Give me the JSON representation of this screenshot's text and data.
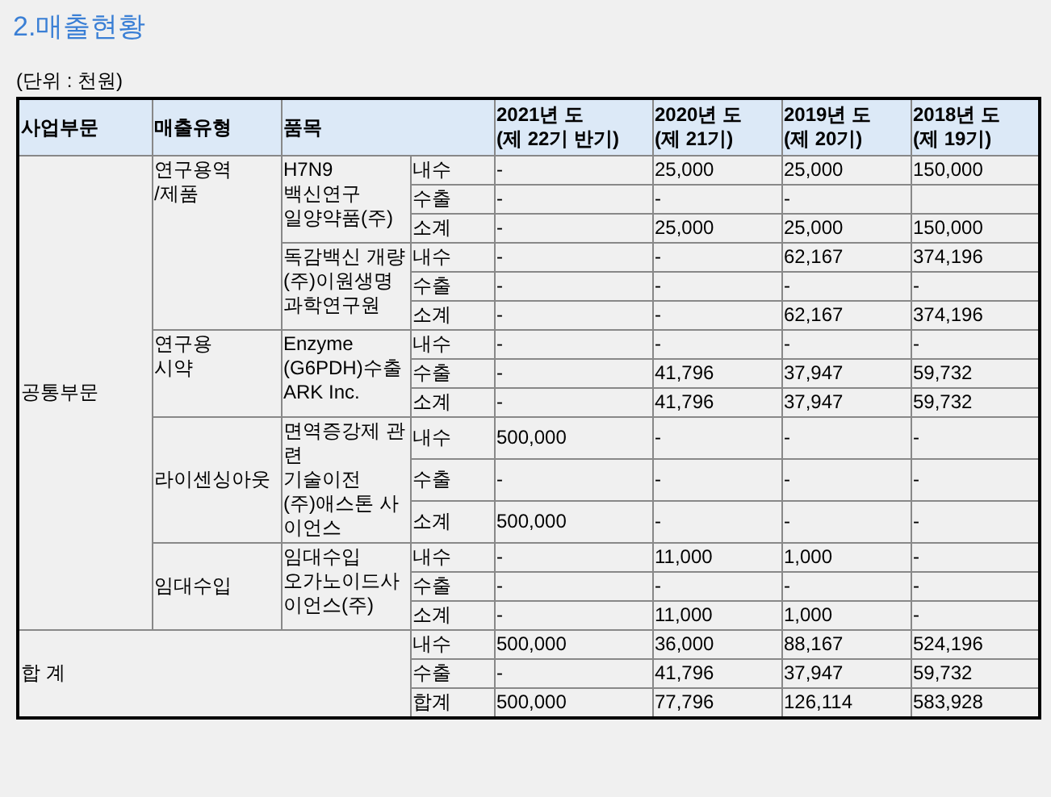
{
  "title": "2.매출현황",
  "unit": "(단위 : 천원)",
  "columns": [
    {
      "lines": [
        "사업부문"
      ]
    },
    {
      "lines": [
        "매출유형"
      ]
    },
    {
      "lines": [
        "품목"
      ]
    },
    {
      "lines": [
        "2021년 도",
        "(제 22기  반기)"
      ]
    },
    {
      "lines": [
        "2020년 도",
        "(제 21기)"
      ]
    },
    {
      "lines": [
        "2019년 도",
        "(제 20기)"
      ]
    },
    {
      "lines": [
        "2018년 도",
        "(제 19기)"
      ]
    }
  ],
  "segments": [
    {
      "name": "공통부문",
      "types": [
        {
          "lines": [
            "연구용역",
            "/제품"
          ],
          "items": [
            {
              "lines": [
                "H7N9",
                "백신연구",
                "일양약품(주)"
              ],
              "rows": [
                {
                  "label": "내수",
                  "values": [
                    "-",
                    "25,000",
                    "25,000",
                    "150,000"
                  ]
                },
                {
                  "label": "수출",
                  "values": [
                    "-",
                    "-",
                    "-"
                  ]
                },
                {
                  "label": "소계",
                  "values": [
                    "-",
                    "25,000",
                    "25,000",
                    "150,000"
                  ]
                }
              ]
            },
            {
              "lines": [
                "독감백신 개량",
                "(주)이원생명",
                "과학연구원"
              ],
              "rows": [
                {
                  "label": "내수",
                  "values": [
                    "-",
                    "-",
                    "62,167",
                    "374,196"
                  ]
                },
                {
                  "label": "수출",
                  "values": [
                    "-",
                    "-",
                    "-",
                    "-"
                  ]
                },
                {
                  "label": "소계",
                  "values": [
                    "-",
                    "-",
                    "62,167",
                    "374,196"
                  ]
                }
              ]
            }
          ]
        },
        {
          "lines": [
            "연구용",
            "시약"
          ],
          "items": [
            {
              "lines": [
                "Enzyme",
                "(G6PDH)수출",
                "ARK Inc."
              ],
              "rows": [
                {
                  "label": "내수",
                  "values": [
                    "-",
                    "-",
                    "-",
                    "-"
                  ]
                },
                {
                  "label": "수출",
                  "values": [
                    "-",
                    "41,796",
                    "37,947",
                    "59,732"
                  ]
                },
                {
                  "label": "소계",
                  "values": [
                    "-",
                    "41,796",
                    "37,947",
                    "59,732"
                  ]
                }
              ]
            }
          ]
        },
        {
          "lines": [
            "라이센싱아웃"
          ],
          "items": [
            {
              "lines": [
                "면역증강제 관련",
                "기술이전",
                "(주)애스톤 사이언스"
              ],
              "rows": [
                {
                  "label": "내수",
                  "values": [
                    "500,000",
                    "-",
                    "-",
                    "-"
                  ]
                },
                {
                  "label": "수출",
                  "values": [
                    "-",
                    "-",
                    "-",
                    "-"
                  ]
                },
                {
                  "label": "소계",
                  "values": [
                    "500,000",
                    "-",
                    "-",
                    "-"
                  ]
                }
              ]
            }
          ]
        },
        {
          "lines": [
            "임대수입"
          ],
          "items": [
            {
              "lines": [
                "임대수입",
                "오가노이드사이언스(주)"
              ],
              "rows": [
                {
                  "label": "내수",
                  "values": [
                    "-",
                    "11,000",
                    "1,000",
                    "-"
                  ]
                },
                {
                  "label": "수출",
                  "values": [
                    "-",
                    "-",
                    "-",
                    "-"
                  ]
                },
                {
                  "label": "소계",
                  "values": [
                    "-",
                    "11,000",
                    "1,000",
                    "-"
                  ]
                }
              ]
            }
          ]
        }
      ]
    }
  ],
  "total": {
    "name": "합 계",
    "rows": [
      {
        "label": "내수",
        "values": [
          "500,000",
          "36,000",
          "88,167",
          "524,196"
        ]
      },
      {
        "label": "수출",
        "values": [
          "-",
          "41,796",
          "37,947",
          "59,732"
        ]
      },
      {
        "label": "합계",
        "values": [
          "500,000",
          "77,796",
          "126,114",
          "583,928"
        ]
      }
    ]
  }
}
